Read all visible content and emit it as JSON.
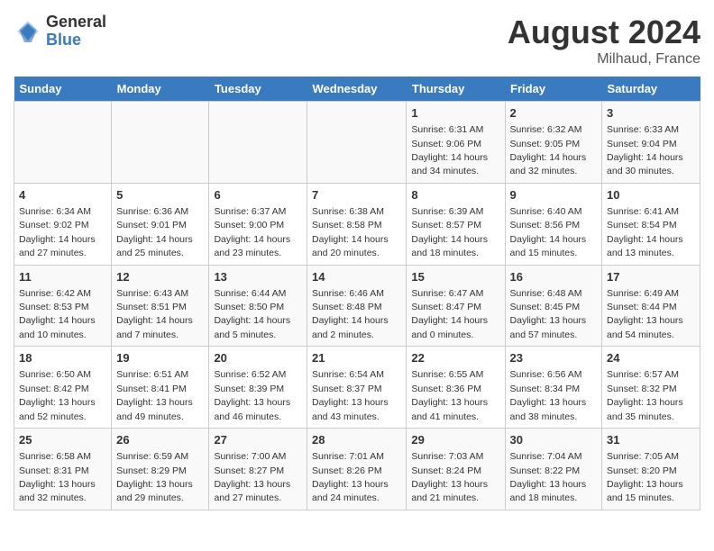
{
  "header": {
    "logo_general": "General",
    "logo_blue": "Blue",
    "month_year": "August 2024",
    "location": "Milhaud, France"
  },
  "days_of_week": [
    "Sunday",
    "Monday",
    "Tuesday",
    "Wednesday",
    "Thursday",
    "Friday",
    "Saturday"
  ],
  "weeks": [
    [
      {
        "day": "",
        "info": ""
      },
      {
        "day": "",
        "info": ""
      },
      {
        "day": "",
        "info": ""
      },
      {
        "day": "",
        "info": ""
      },
      {
        "day": "1",
        "info": "Sunrise: 6:31 AM\nSunset: 9:06 PM\nDaylight: 14 hours\nand 34 minutes."
      },
      {
        "day": "2",
        "info": "Sunrise: 6:32 AM\nSunset: 9:05 PM\nDaylight: 14 hours\nand 32 minutes."
      },
      {
        "day": "3",
        "info": "Sunrise: 6:33 AM\nSunset: 9:04 PM\nDaylight: 14 hours\nand 30 minutes."
      }
    ],
    [
      {
        "day": "4",
        "info": "Sunrise: 6:34 AM\nSunset: 9:02 PM\nDaylight: 14 hours\nand 27 minutes."
      },
      {
        "day": "5",
        "info": "Sunrise: 6:36 AM\nSunset: 9:01 PM\nDaylight: 14 hours\nand 25 minutes."
      },
      {
        "day": "6",
        "info": "Sunrise: 6:37 AM\nSunset: 9:00 PM\nDaylight: 14 hours\nand 23 minutes."
      },
      {
        "day": "7",
        "info": "Sunrise: 6:38 AM\nSunset: 8:58 PM\nDaylight: 14 hours\nand 20 minutes."
      },
      {
        "day": "8",
        "info": "Sunrise: 6:39 AM\nSunset: 8:57 PM\nDaylight: 14 hours\nand 18 minutes."
      },
      {
        "day": "9",
        "info": "Sunrise: 6:40 AM\nSunset: 8:56 PM\nDaylight: 14 hours\nand 15 minutes."
      },
      {
        "day": "10",
        "info": "Sunrise: 6:41 AM\nSunset: 8:54 PM\nDaylight: 14 hours\nand 13 minutes."
      }
    ],
    [
      {
        "day": "11",
        "info": "Sunrise: 6:42 AM\nSunset: 8:53 PM\nDaylight: 14 hours\nand 10 minutes."
      },
      {
        "day": "12",
        "info": "Sunrise: 6:43 AM\nSunset: 8:51 PM\nDaylight: 14 hours\nand 7 minutes."
      },
      {
        "day": "13",
        "info": "Sunrise: 6:44 AM\nSunset: 8:50 PM\nDaylight: 14 hours\nand 5 minutes."
      },
      {
        "day": "14",
        "info": "Sunrise: 6:46 AM\nSunset: 8:48 PM\nDaylight: 14 hours\nand 2 minutes."
      },
      {
        "day": "15",
        "info": "Sunrise: 6:47 AM\nSunset: 8:47 PM\nDaylight: 14 hours\nand 0 minutes."
      },
      {
        "day": "16",
        "info": "Sunrise: 6:48 AM\nSunset: 8:45 PM\nDaylight: 13 hours\nand 57 minutes."
      },
      {
        "day": "17",
        "info": "Sunrise: 6:49 AM\nSunset: 8:44 PM\nDaylight: 13 hours\nand 54 minutes."
      }
    ],
    [
      {
        "day": "18",
        "info": "Sunrise: 6:50 AM\nSunset: 8:42 PM\nDaylight: 13 hours\nand 52 minutes."
      },
      {
        "day": "19",
        "info": "Sunrise: 6:51 AM\nSunset: 8:41 PM\nDaylight: 13 hours\nand 49 minutes."
      },
      {
        "day": "20",
        "info": "Sunrise: 6:52 AM\nSunset: 8:39 PM\nDaylight: 13 hours\nand 46 minutes."
      },
      {
        "day": "21",
        "info": "Sunrise: 6:54 AM\nSunset: 8:37 PM\nDaylight: 13 hours\nand 43 minutes."
      },
      {
        "day": "22",
        "info": "Sunrise: 6:55 AM\nSunset: 8:36 PM\nDaylight: 13 hours\nand 41 minutes."
      },
      {
        "day": "23",
        "info": "Sunrise: 6:56 AM\nSunset: 8:34 PM\nDaylight: 13 hours\nand 38 minutes."
      },
      {
        "day": "24",
        "info": "Sunrise: 6:57 AM\nSunset: 8:32 PM\nDaylight: 13 hours\nand 35 minutes."
      }
    ],
    [
      {
        "day": "25",
        "info": "Sunrise: 6:58 AM\nSunset: 8:31 PM\nDaylight: 13 hours\nand 32 minutes."
      },
      {
        "day": "26",
        "info": "Sunrise: 6:59 AM\nSunset: 8:29 PM\nDaylight: 13 hours\nand 29 minutes."
      },
      {
        "day": "27",
        "info": "Sunrise: 7:00 AM\nSunset: 8:27 PM\nDaylight: 13 hours\nand 27 minutes."
      },
      {
        "day": "28",
        "info": "Sunrise: 7:01 AM\nSunset: 8:26 PM\nDaylight: 13 hours\nand 24 minutes."
      },
      {
        "day": "29",
        "info": "Sunrise: 7:03 AM\nSunset: 8:24 PM\nDaylight: 13 hours\nand 21 minutes."
      },
      {
        "day": "30",
        "info": "Sunrise: 7:04 AM\nSunset: 8:22 PM\nDaylight: 13 hours\nand 18 minutes."
      },
      {
        "day": "31",
        "info": "Sunrise: 7:05 AM\nSunset: 8:20 PM\nDaylight: 13 hours\nand 15 minutes."
      }
    ]
  ]
}
